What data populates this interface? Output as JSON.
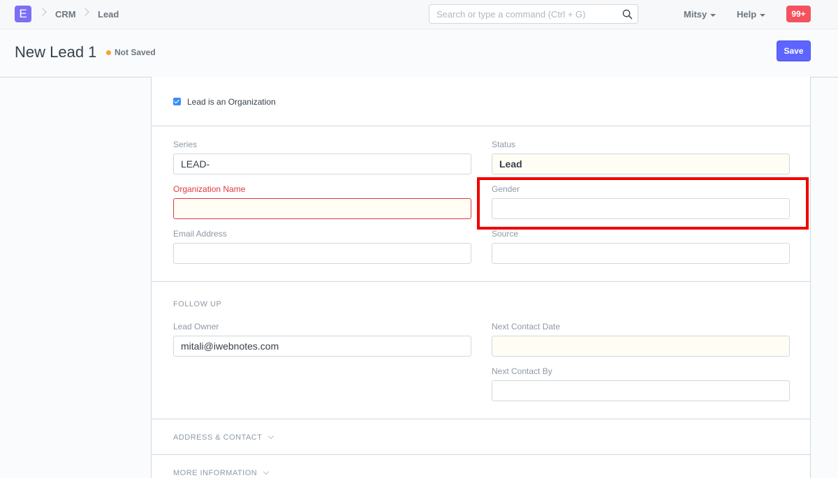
{
  "navbar": {
    "logo_letter": "E",
    "breadcrumbs": [
      "CRM",
      "Lead"
    ],
    "search_placeholder": "Search or type a command (Ctrl + G)",
    "user_menu": "Mitsy",
    "help_menu": "Help",
    "notifications": "99+"
  },
  "page": {
    "title": "New Lead 1",
    "status": "Not Saved",
    "save_label": "Save"
  },
  "form": {
    "org_checkbox_label": "Lead is an Organization",
    "org_checkbox_checked": true,
    "series_label": "Series",
    "series_value": "LEAD-",
    "status_label": "Status",
    "status_value": "Lead",
    "org_name_label": "Organization Name",
    "org_name_value": "",
    "gender_label": "Gender",
    "gender_value": "",
    "email_label": "Email Address",
    "email_value": "",
    "source_label": "Source",
    "source_value": "",
    "follow_up_heading": "FOLLOW UP",
    "lead_owner_label": "Lead Owner",
    "lead_owner_value": "mitali@iwebnotes.com",
    "next_contact_date_label": "Next Contact Date",
    "next_contact_date_value": "",
    "next_contact_by_label": "Next Contact By",
    "next_contact_by_value": "",
    "address_section": "ADDRESS & CONTACT",
    "more_info_section": "MORE INFORMATION"
  },
  "colors": {
    "accent": "#5e64ff",
    "logo": "#7c6ef5",
    "badge": "#f4525f",
    "error": "#e0383f",
    "highlight": "#f00000"
  }
}
